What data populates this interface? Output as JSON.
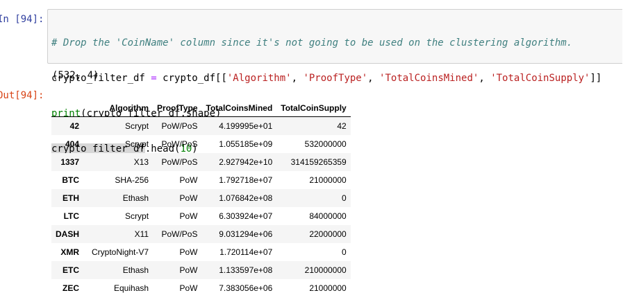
{
  "cell": {
    "in_prompt": "In [94]:",
    "out_prompt": "Out[94]:",
    "code": {
      "line1_comment": "# Drop the 'CoinName' column since it's not going to be used on the clustering algorithm.",
      "line2": {
        "var": "crypto_filter_df",
        "eq": " = ",
        "src": "crypto_df[[",
        "s1": "'Algorithm'",
        "sep1": ", ",
        "s2": "'ProofType'",
        "sep2": ", ",
        "s3": "'TotalCoinsMined'",
        "sep3": ", ",
        "s4": "'TotalCoinSupply'",
        "end": "]]"
      },
      "line3": {
        "fn": "print",
        "args": "(crypto_filter_df.shape)"
      },
      "line4": {
        "hl": "crypto_filter_df",
        "method": ".head(",
        "num": "10",
        "close": ")"
      }
    },
    "stdout": "(532, 4)"
  },
  "dataframe": {
    "columns": [
      "",
      "Algorithm",
      "ProofType",
      "TotalCoinsMined",
      "TotalCoinSupply"
    ],
    "rows": [
      {
        "index": "42",
        "Algorithm": "Scrypt",
        "ProofType": "PoW/PoS",
        "TotalCoinsMined": "4.199995e+01",
        "TotalCoinSupply": "42"
      },
      {
        "index": "404",
        "Algorithm": "Scrypt",
        "ProofType": "PoW/PoS",
        "TotalCoinsMined": "1.055185e+09",
        "TotalCoinSupply": "532000000"
      },
      {
        "index": "1337",
        "Algorithm": "X13",
        "ProofType": "PoW/PoS",
        "TotalCoinsMined": "2.927942e+10",
        "TotalCoinSupply": "314159265359"
      },
      {
        "index": "BTC",
        "Algorithm": "SHA-256",
        "ProofType": "PoW",
        "TotalCoinsMined": "1.792718e+07",
        "TotalCoinSupply": "21000000"
      },
      {
        "index": "ETH",
        "Algorithm": "Ethash",
        "ProofType": "PoW",
        "TotalCoinsMined": "1.076842e+08",
        "TotalCoinSupply": "0"
      },
      {
        "index": "LTC",
        "Algorithm": "Scrypt",
        "ProofType": "PoW",
        "TotalCoinsMined": "6.303924e+07",
        "TotalCoinSupply": "84000000"
      },
      {
        "index": "DASH",
        "Algorithm": "X11",
        "ProofType": "PoW/PoS",
        "TotalCoinsMined": "9.031294e+06",
        "TotalCoinSupply": "22000000"
      },
      {
        "index": "XMR",
        "Algorithm": "CryptoNight-V7",
        "ProofType": "PoW",
        "TotalCoinsMined": "1.720114e+07",
        "TotalCoinSupply": "0"
      },
      {
        "index": "ETC",
        "Algorithm": "Ethash",
        "ProofType": "PoW",
        "TotalCoinsMined": "1.133597e+08",
        "TotalCoinSupply": "210000000"
      },
      {
        "index": "ZEC",
        "Algorithm": "Equihash",
        "ProofType": "PoW",
        "TotalCoinsMined": "7.383056e+06",
        "TotalCoinSupply": "21000000"
      }
    ]
  },
  "colors": {
    "in_prompt": "#303f9f",
    "out_prompt": "#d84315",
    "cell_bg": "#f7f7f7",
    "comment": "#408080",
    "string": "#ba2121",
    "builtin": "#008000",
    "operator": "#aa22ff"
  }
}
